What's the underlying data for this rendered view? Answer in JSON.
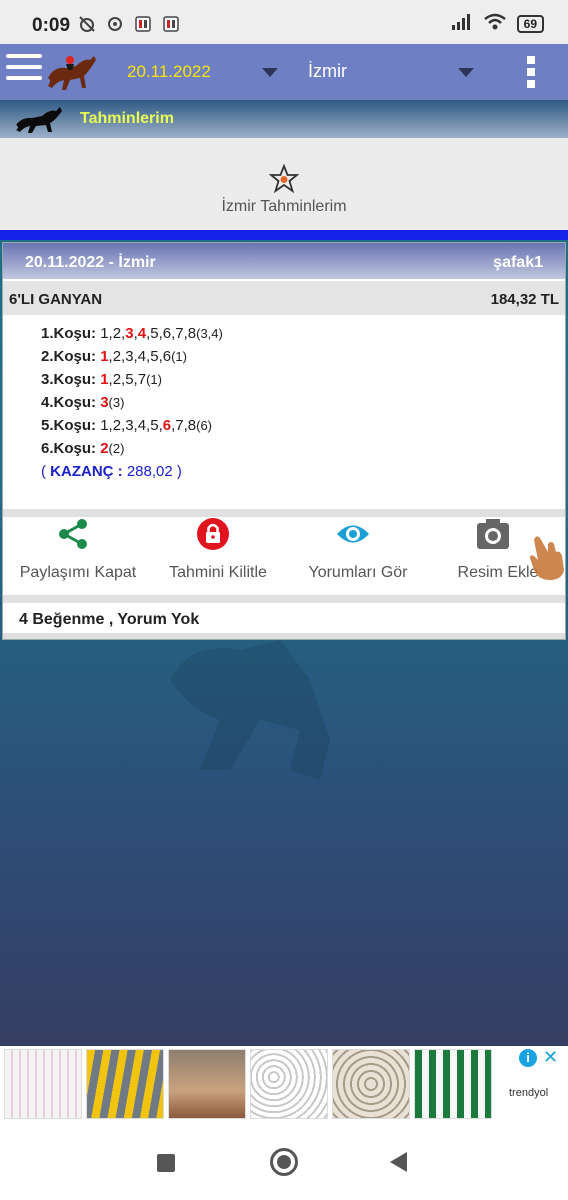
{
  "status": {
    "time": "0:09",
    "battery": "69",
    "icons": [
      "alarm-off-icon",
      "sync-icon",
      "app-notification-icon",
      "app-notification-icon",
      "signal-icon",
      "wifi-icon"
    ]
  },
  "appbar": {
    "date": "20.11.2022",
    "city": "İzmir"
  },
  "subheader": {
    "title": "Tahminlerim"
  },
  "section": {
    "title": "İzmir Tahminlerim"
  },
  "card": {
    "header_date": "20.11.2022 - İzmir",
    "user": "şafak1",
    "bet_type": "6'LI GANYAN",
    "bet_amount": "184,32 TL",
    "races": [
      {
        "label": "1.Koşu:",
        "parts": [
          {
            "t": "1,2,",
            "w": false
          },
          {
            "t": "3",
            "w": true
          },
          {
            "t": ",",
            "w": false
          },
          {
            "t": "4",
            "w": true
          },
          {
            "t": ",5,6,7,8",
            "w": false
          }
        ],
        "count": "(3,4)"
      },
      {
        "label": "2.Koşu:",
        "parts": [
          {
            "t": "1",
            "w": true
          },
          {
            "t": ",2,3,4,5,6",
            "w": false
          }
        ],
        "count": "(1)"
      },
      {
        "label": "3.Koşu:",
        "parts": [
          {
            "t": "1",
            "w": true
          },
          {
            "t": ",2,5,7",
            "w": false
          }
        ],
        "count": "(1)"
      },
      {
        "label": "4.Koşu:",
        "parts": [
          {
            "t": "3",
            "w": true
          }
        ],
        "count": "(3)"
      },
      {
        "label": "5.Koşu:",
        "parts": [
          {
            "t": "1,2,3,4,5,",
            "w": false
          },
          {
            "t": "6",
            "w": true
          },
          {
            "t": ",7,8",
            "w": false
          }
        ],
        "count": "(6)"
      },
      {
        "label": "6.Koşu:",
        "parts": [
          {
            "t": "2",
            "w": true
          }
        ],
        "count": "(2)"
      }
    ],
    "kazanc_open": "( ",
    "kazanc_label": "KAZANÇ :",
    "kazanc_value": " 288,02 )",
    "actions": [
      {
        "label": "Paylaşımı Kapat",
        "icon": "share-icon",
        "color": "#1b8a4a"
      },
      {
        "label": "Tahmini Kilitle",
        "icon": "lock-icon",
        "color": "#e0141e"
      },
      {
        "label": "Yorumları Gör",
        "icon": "eye-icon",
        "color": "#1a9fd6"
      },
      {
        "label": "Resim Ekle",
        "icon": "camera-icon",
        "color": "#666666"
      }
    ],
    "likes": "4 Beğenme , Yorum Yok"
  },
  "ad": {
    "brand": "trendyol",
    "info_label": "i",
    "close_label": "✕"
  }
}
